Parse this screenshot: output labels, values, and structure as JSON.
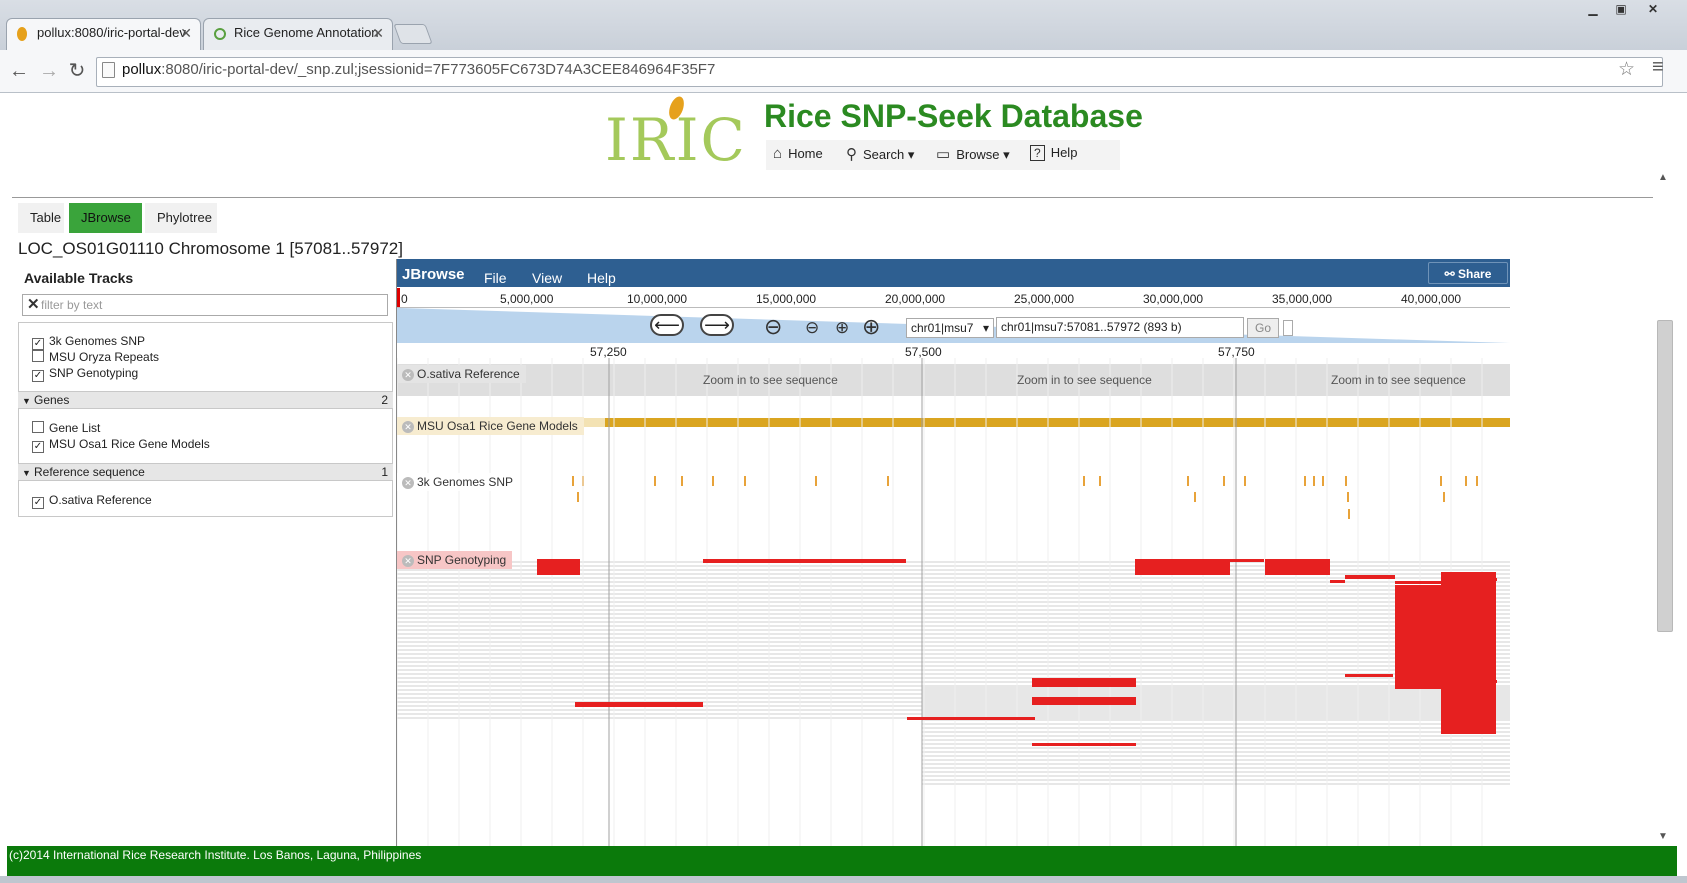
{
  "browser": {
    "tabs": [
      {
        "title": "pollux:8080/iric-portal-dev"
      },
      {
        "title": "Rice Genome Annotation"
      }
    ],
    "url_host": "pollux",
    "url_rest": ":8080/iric-portal-dev/_snp.zul;jsessionid=7F773605FC673D74A3CEE846964F35F7",
    "colors": {
      "chrome": "#d5dbe2"
    }
  },
  "header": {
    "logo_text": "IRIC",
    "site_title": "Rice SNP-Seek Database",
    "nav": [
      {
        "label": "Home",
        "icon": "home-icon"
      },
      {
        "label": "Search",
        "icon": "search-icon"
      },
      {
        "label": "Browse",
        "icon": "browse-icon"
      },
      {
        "label": "Help",
        "icon": "help-icon"
      }
    ],
    "colors": {
      "title": "#2b8a21",
      "logo": "#a4c95b"
    }
  },
  "view_tabs": [
    {
      "label": "Table",
      "active": false
    },
    {
      "label": "JBrowse",
      "active": true
    },
    {
      "label": "Phylotree",
      "active": false
    }
  ],
  "locus_title": "LOC_OS01G01110 Chromosome 1 [57081..57972]",
  "track_selector": {
    "title": "Available Tracks",
    "filter_placeholder": "filter by text",
    "ungrouped": [
      {
        "label": "3k Genomes SNP",
        "checked": true
      },
      {
        "label": "MSU Oryza Repeats",
        "checked": false
      },
      {
        "label": "SNP Genotyping",
        "checked": true
      }
    ],
    "categories": [
      {
        "name": "Genes",
        "count": "2",
        "items": [
          {
            "label": "Gene List",
            "checked": false
          },
          {
            "label": "MSU Osa1 Rice Gene Models",
            "checked": true
          }
        ]
      },
      {
        "name": "Reference sequence",
        "count": "1",
        "items": [
          {
            "label": "O.sativa Reference",
            "checked": true
          }
        ]
      }
    ]
  },
  "jbrowse": {
    "logo": "JBrowse",
    "menus": [
      "File",
      "View",
      "Help"
    ],
    "share_label": "Share",
    "overview_ticks": [
      "0",
      "5,000,000",
      "10,000,000",
      "15,000,000",
      "20,000,000",
      "25,000,000",
      "30,000,000",
      "35,000,000",
      "40,000,000"
    ],
    "ref_select": "chr01|msu7",
    "location": "chr01|msu7:57081..57972 (893 b)",
    "go_label": "Go",
    "scale_ticks": [
      "57,250",
      "57,500",
      "57,750"
    ],
    "tracks": {
      "reference": {
        "label": "O.sativa Reference",
        "message": "Zoom in to see sequence"
      },
      "genes": {
        "label": "MSU Osa1 Rice Gene Models"
      },
      "snp3k": {
        "label": "3k Genomes SNP"
      },
      "genotyping": {
        "label": "SNP Genotyping"
      }
    },
    "colors": {
      "menubar": "#2e5f91",
      "gene": "#daa520",
      "snp": "#e8a33a",
      "genotype": "#e62020",
      "ref_band": "#dedede"
    }
  },
  "footer": {
    "text": "(c)2014 International Rice Research Institute. Los Banos, Laguna, Philippines",
    "color": "#0b7a0b"
  }
}
